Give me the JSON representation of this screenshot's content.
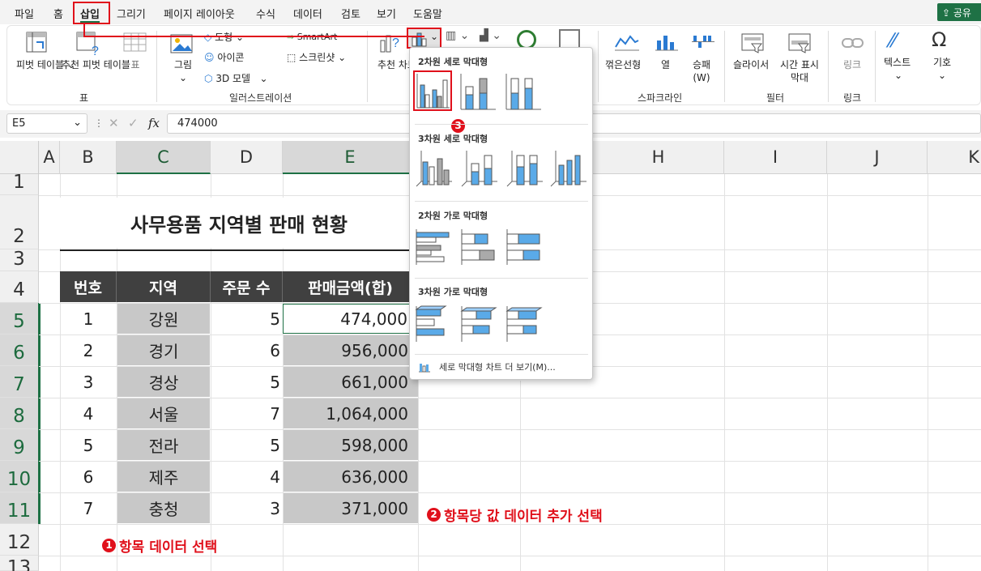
{
  "menu": {
    "tabs": [
      "파일",
      "홈",
      "삽입",
      "그리기",
      "페이지 레이아웃",
      "수식",
      "데이터",
      "검토",
      "보기",
      "도움말"
    ],
    "share_label": "공유"
  },
  "ribbon": {
    "pivot_table": "피벗 테이블",
    "recommended_pivot": "추천 피벗 테이블",
    "table": "표",
    "picture": "그림",
    "shapes": "도형",
    "icons": "아이콘",
    "model3d": "3D 모델",
    "smartart": "SmartArt",
    "screenshot": "스크린샷",
    "recommended_chart": "추천 차트",
    "line": "꺾은선형",
    "column": "열",
    "win_loss": "승패 (W)",
    "slicer": "슬라이서",
    "timeline": "시간 표시 막대",
    "link": "링크",
    "text": "텍스트",
    "symbol": "기호",
    "groups": {
      "table": "표",
      "illustrations": "일러스트레이션",
      "sparklines": "스파크라인",
      "filter": "필터",
      "link": "링크"
    }
  },
  "formula_bar": {
    "name_box": "E5",
    "fx": "fx",
    "value": "474000"
  },
  "columns": [
    "A",
    "B",
    "C",
    "D",
    "E",
    "H",
    "I",
    "J",
    "K"
  ],
  "rows": [
    "1",
    "2",
    "3",
    "4",
    "5",
    "6",
    "7",
    "8",
    "9",
    "10",
    "11",
    "12",
    "13"
  ],
  "sheet": {
    "title": "사무용품 지역별 판매 현황",
    "headers": [
      "번호",
      "지역",
      "주문 수",
      "판매금액(합)"
    ],
    "data": [
      [
        "1",
        "강원",
        "5",
        "474,000"
      ],
      [
        "2",
        "경기",
        "6",
        "956,000"
      ],
      [
        "3",
        "경상",
        "5",
        "661,000"
      ],
      [
        "4",
        "서울",
        "7",
        "1,064,000"
      ],
      [
        "5",
        "전라",
        "5",
        "598,000"
      ],
      [
        "6",
        "제주",
        "4",
        "636,000"
      ],
      [
        "7",
        "충청",
        "3",
        "371,000"
      ]
    ]
  },
  "annotations": {
    "step1": "항목 데이터 선택",
    "step2": "항목당 값 데이터 추가 선택",
    "n1": "1",
    "n2": "2",
    "n3": "3"
  },
  "dropdown": {
    "section1": "2차원 세로 막대형",
    "section2": "3차원 세로 막대형",
    "section3": "2차원 가로 막대형",
    "section4": "3차원 가로 막대형",
    "more": "세로 막대형 차트 더 보기(M)..."
  },
  "colors": {
    "accent_red": "#e0101b",
    "excel_green": "#1e7145",
    "bar_blue": "#5aaae8"
  }
}
